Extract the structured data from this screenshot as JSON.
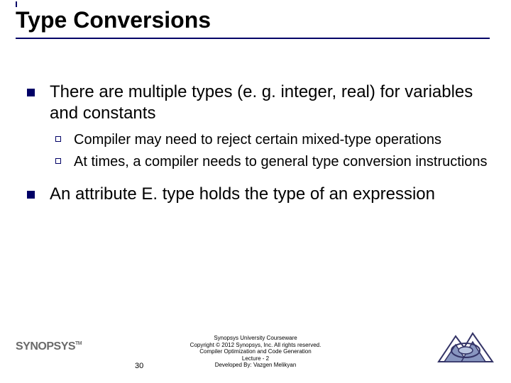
{
  "title": "Type Conversions",
  "bullets": {
    "b1": "There are multiple types (e. g. integer, real) for variables and constants",
    "b1a": "Compiler may need to reject certain mixed-type operations",
    "b1b": "At times, a compiler needs to general type conversion instructions",
    "b2": "An attribute E. type holds the type of an expression"
  },
  "footer": {
    "line1": "Synopsys University Courseware",
    "line2": "Copyright © 2012 Synopsys, Inc. All rights reserved.",
    "line3": "Compiler Optimization and Code Generation",
    "line4": "Lecture - 2",
    "line5": "Developed By: Vazgen Melikyan"
  },
  "slide_number": "30",
  "logo_left_text": "SYNOPSYS",
  "logo_left_tm": "TM"
}
